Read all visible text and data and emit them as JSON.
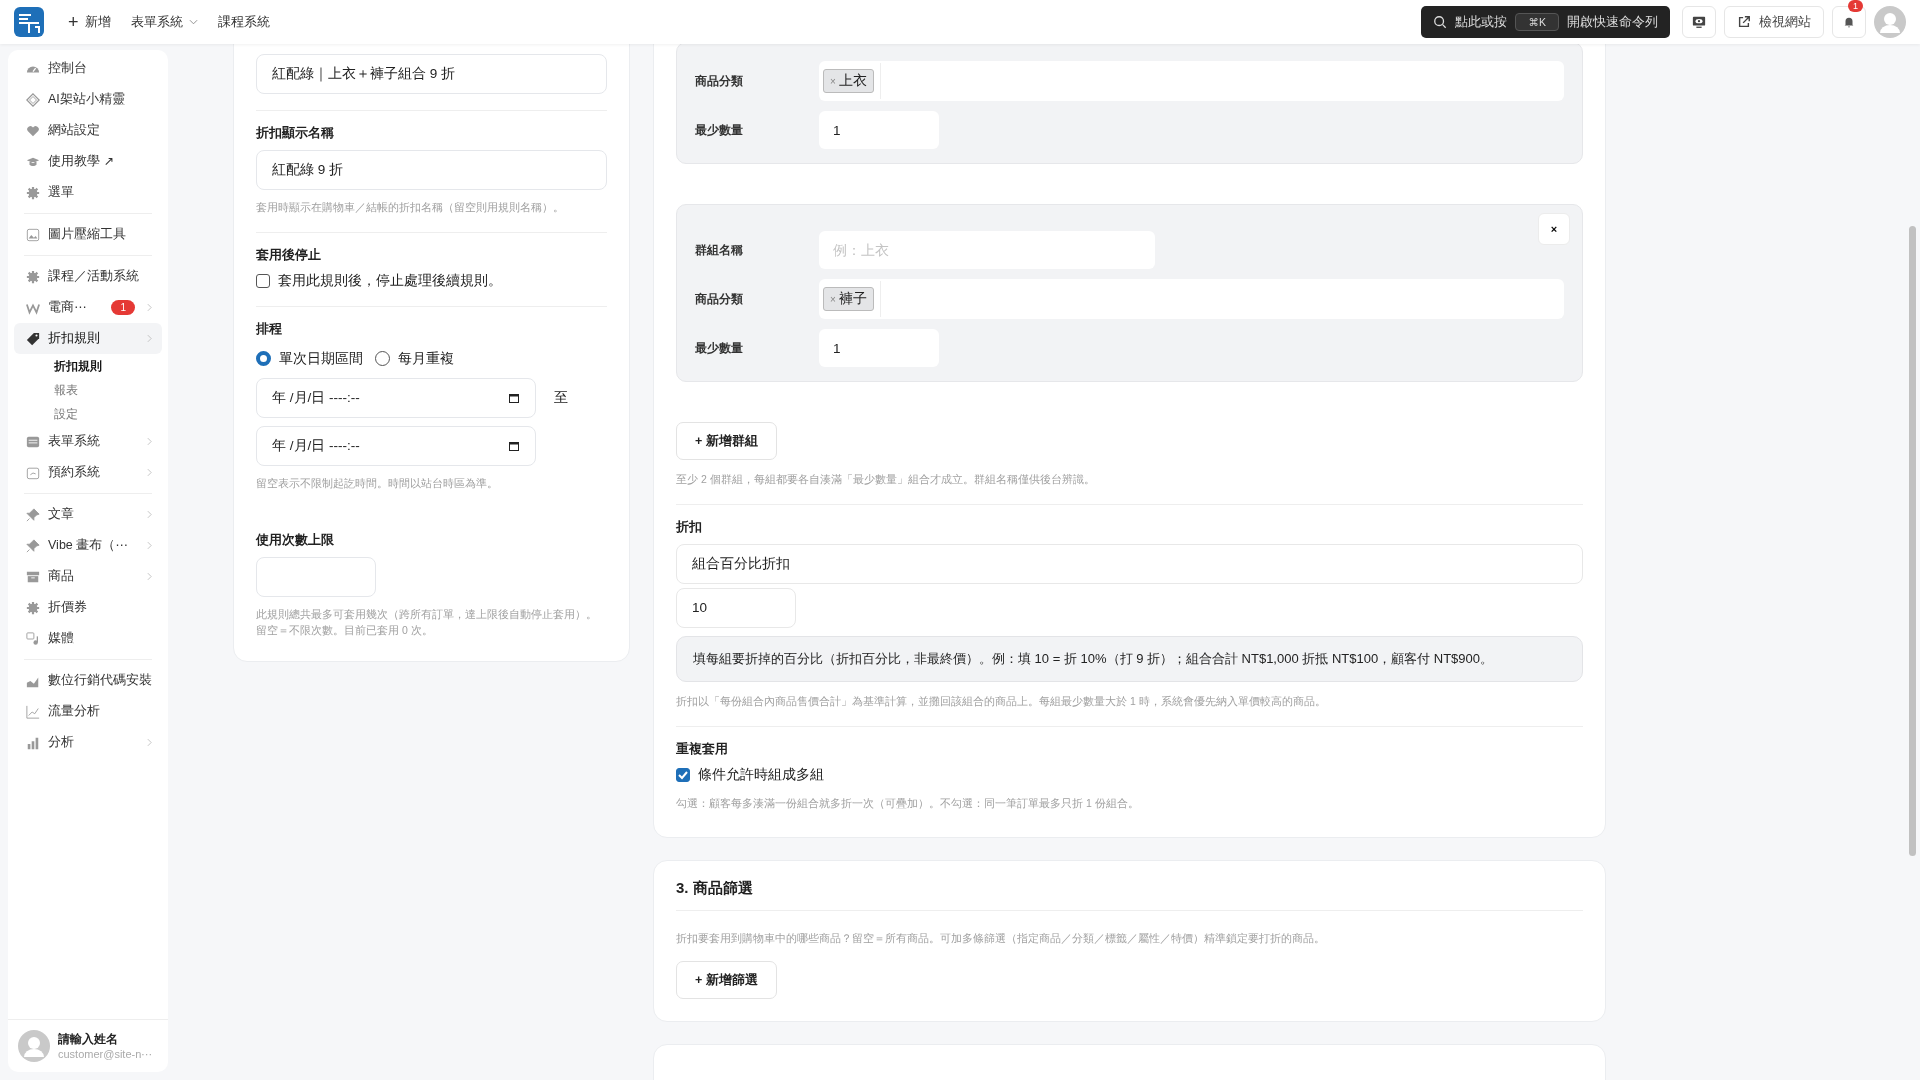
{
  "topbar": {
    "new_button": {
      "icon": "+",
      "label": "新增"
    },
    "menus": [
      {
        "label": "表單系統",
        "dropdown": true
      },
      {
        "label": "課程系統",
        "dropdown": false
      }
    ],
    "command": {
      "prefix": "點此或按",
      "shortcut": "⌘K",
      "suffix": "開啟快速命令列"
    },
    "view_site": "檢視網站",
    "notification_count": "1"
  },
  "sidebar": {
    "groups": [
      [
        {
          "label": "控制台",
          "chevron": false,
          "selected": false
        },
        {
          "label": "AI架站小精靈",
          "chevron": false,
          "selected": false
        },
        {
          "label": "網站設定",
          "chevron": false,
          "selected": false
        },
        {
          "label": "使用教學 ↗",
          "chevron": false,
          "selected": false
        },
        {
          "label": "選單",
          "chevron": false,
          "selected": false
        }
      ],
      [
        {
          "label": "圖片壓縮工具",
          "chevron": false,
          "selected": false
        }
      ],
      [
        {
          "label": "課程／活動系統",
          "chevron": false,
          "selected": false
        },
        {
          "label": "電商⋯",
          "badge": "1",
          "chevron": true,
          "selected": false
        },
        {
          "label": "折扣規則",
          "chevron": true,
          "selected": true,
          "children": [
            {
              "label": "折扣規則",
              "selected": true
            },
            {
              "label": "報表",
              "selected": false
            },
            {
              "label": "設定",
              "selected": false
            }
          ]
        },
        {
          "label": "表單系統",
          "chevron": true,
          "selected": false
        },
        {
          "label": "預約系統",
          "chevron": true,
          "selected": false
        }
      ],
      [
        {
          "label": "文章",
          "chevron": true,
          "selected": false
        },
        {
          "label": "Vibe 畫布（⋯",
          "chevron": true,
          "selected": false
        },
        {
          "label": "商品",
          "chevron": true,
          "selected": false
        },
        {
          "label": "折價券",
          "chevron": false,
          "selected": false
        },
        {
          "label": "媒體",
          "chevron": false,
          "selected": false
        }
      ],
      [
        {
          "label": "數位行銷代碼安裝",
          "chevron": false,
          "selected": false
        },
        {
          "label": "流量分析",
          "chevron": false,
          "selected": false
        },
        {
          "label": "分析",
          "chevron": true,
          "selected": false
        }
      ]
    ],
    "user": {
      "name": "請輸入姓名",
      "email": "customer@site-n⋯"
    }
  },
  "rule_card": {
    "rule_name": {
      "value": "紅配綠｜上衣＋褲子組合 9 折"
    },
    "display_name": {
      "label": "折扣顯示名稱",
      "value": "紅配綠 9 折",
      "hint": "套用時顯示在購物車／結帳的折扣名稱（留空則用規則名稱）。"
    },
    "stop_after": {
      "label": "套用後停止",
      "checkbox_label": "套用此規則後，停止處理後續規則。",
      "checked": false
    },
    "schedule": {
      "label": "排程",
      "options": [
        {
          "label": "單次日期區間",
          "selected": true
        },
        {
          "label": "每月重複",
          "selected": false
        }
      ],
      "start": "年 /月/日 ----:--",
      "separator": "至",
      "end": "年 /月/日 ----:--",
      "hint": "留空表示不限制起訖時間。時間以站台時區為準。"
    },
    "usage_limit": {
      "label": "使用次數上限",
      "hint_lines": [
        "此規則總共最多可套用幾次（跨所有訂單，達上限後自動停止套用）。",
        "留空＝不限次數。目前已套用 0 次。"
      ]
    }
  },
  "groups_card": {
    "groups": [
      {
        "removable": false,
        "fields": [
          {
            "kind": "tags",
            "label": "商品分類",
            "tags": [
              {
                "remove": "×",
                "label": "上衣"
              }
            ]
          },
          {
            "kind": "number",
            "label": "最少數量",
            "value": "1"
          }
        ]
      },
      {
        "removable": true,
        "remove": "×",
        "fields": [
          {
            "kind": "text",
            "label": "群組名稱",
            "placeholder": "例：上衣"
          },
          {
            "kind": "tags",
            "label": "商品分類",
            "tags": [
              {
                "remove": "×",
                "label": "褲子"
              }
            ]
          },
          {
            "kind": "number",
            "label": "最少數量",
            "value": "1"
          }
        ]
      }
    ],
    "add_group": "+ 新增群組",
    "groups_hint": "至少 2 個群組，每組都要各自湊滿「最少數量」組合才成立。群組名稱僅供後台辨識。",
    "discount": {
      "label": "折扣",
      "type_value": "組合百分比折扣",
      "amount": "10",
      "info": "填每組要折掉的百分比（折扣百分比，非最終價）。例：填 10 = 折 10%（打 9 折）；組合合計 NT$1,000 折抵 NT$100，顧客付 NT$900。",
      "hint": "折扣以「每份組合內商品售價合計」為基準計算，並攤回該組合的商品上。每組最少數量大於 1 時，系統會優先納入單價較高的商品。"
    },
    "repeat": {
      "label": "重複套用",
      "checkbox_label": "條件允許時組成多組",
      "checked": true,
      "hint": "勾選：顧客每多湊滿一份組合就多折一次（可疊加）。不勾選：同一筆訂單最多只折 1 份組合。"
    }
  },
  "filter_card": {
    "title": "3. 商品篩選",
    "hint": "折扣要套用到購物車中的哪些商品？留空＝所有商品。可加多條篩選（指定商品／分類／標籤／屬性／特價）精準鎖定要打折的商品。",
    "add_button": "+ 新增篩選"
  }
}
